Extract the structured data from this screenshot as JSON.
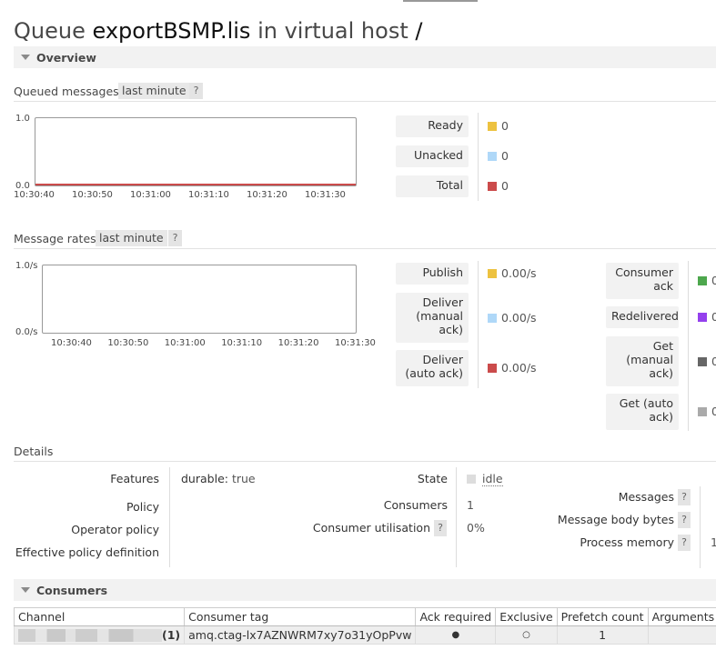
{
  "page": {
    "title_prefix": "Queue",
    "queue_name": "exportBSMP.lis",
    "title_mid": "in virtual host",
    "vhost": "/"
  },
  "overview": {
    "section_label": "Overview",
    "queued_messages": {
      "title": "Queued messages",
      "range": "last minute",
      "help": "?",
      "chart_data": {
        "type": "line",
        "title": "Queued messages",
        "ylim": [
          0,
          1
        ],
        "y_tick_labels": [
          "1.0",
          "0.0"
        ],
        "x_tick_labels": [
          "10:30:40",
          "10:30:50",
          "10:31:00",
          "10:31:10",
          "10:31:20",
          "10:31:30"
        ],
        "series": [
          {
            "name": "Ready",
            "values": [
              0,
              0,
              0,
              0,
              0,
              0
            ],
            "color": "#edc240"
          },
          {
            "name": "Unacked",
            "values": [
              0,
              0,
              0,
              0,
              0,
              0
            ],
            "color": "#afd8f8"
          },
          {
            "name": "Total",
            "values": [
              0,
              0,
              0,
              0,
              0,
              0
            ],
            "color": "#cb4b4b"
          }
        ]
      },
      "legend": [
        {
          "label": "Ready",
          "value": "0",
          "color": "#edc240"
        },
        {
          "label": "Unacked",
          "value": "0",
          "color": "#afd8f8"
        },
        {
          "label": "Total",
          "value": "0",
          "color": "#cb4b4b"
        }
      ]
    },
    "message_rates": {
      "title": "Message rates",
      "range": "last minute",
      "help": "?",
      "chart_data": {
        "type": "line",
        "title": "Message rates",
        "ylim": [
          0,
          1
        ],
        "y_tick_labels": [
          "1.0/s",
          "0.0/s"
        ],
        "x_tick_labels": [
          "10:30:40",
          "10:30:50",
          "10:31:00",
          "10:31:10",
          "10:31:20",
          "10:31:30"
        ],
        "series": []
      },
      "legend_left": [
        {
          "label": "Publish",
          "value": "0.00/s",
          "color": "#edc240"
        },
        {
          "label": "Deliver (manual ack)",
          "value": "0.00/s",
          "color": "#afd8f8"
        },
        {
          "label": "Deliver (auto ack)",
          "value": "0.00/s",
          "color": "#cb4b4b"
        }
      ],
      "legend_right": [
        {
          "label": "Consumer ack",
          "value": "0",
          "color": "#4da74d"
        },
        {
          "label": "Redelivered",
          "value": "0",
          "color": "#9440ed"
        },
        {
          "label": "Get (manual ack)",
          "value": "0",
          "color": "#666666"
        },
        {
          "label": "Get (auto ack)",
          "value": "0",
          "color": "#aaaaaa"
        }
      ]
    }
  },
  "details": {
    "title": "Details",
    "features_label": "Features",
    "features_key": "durable:",
    "features_value": "true",
    "policy_label": "Policy",
    "operator_policy_label": "Operator policy",
    "effective_policy_label": "Effective policy definition",
    "state_label": "State",
    "state_value": "idle",
    "consumers_label": "Consumers",
    "consumers_value": "1",
    "consumer_util_label": "Consumer utilisation",
    "consumer_util_value": "0%",
    "messages_label": "Messages",
    "body_bytes_label": "Message body bytes",
    "process_memory_label": "Process memory",
    "process_memory_value_partial": "1",
    "help": "?"
  },
  "consumers": {
    "section_label": "Consumers",
    "columns": [
      "Channel",
      "Consumer tag",
      "Ack required",
      "Exclusive",
      "Prefetch count",
      "Arguments"
    ],
    "rows": [
      {
        "channel_suffix": "(1)",
        "consumer_tag": "amq.ctag-lx7AZNWRM7xy7o31yOpPvw",
        "ack_required": "●",
        "exclusive": "○",
        "prefetch_count": "1",
        "arguments": ""
      }
    ]
  },
  "colors": {
    "state_idle": "#dddddd",
    "panel_bg": "#f2f2f2"
  }
}
